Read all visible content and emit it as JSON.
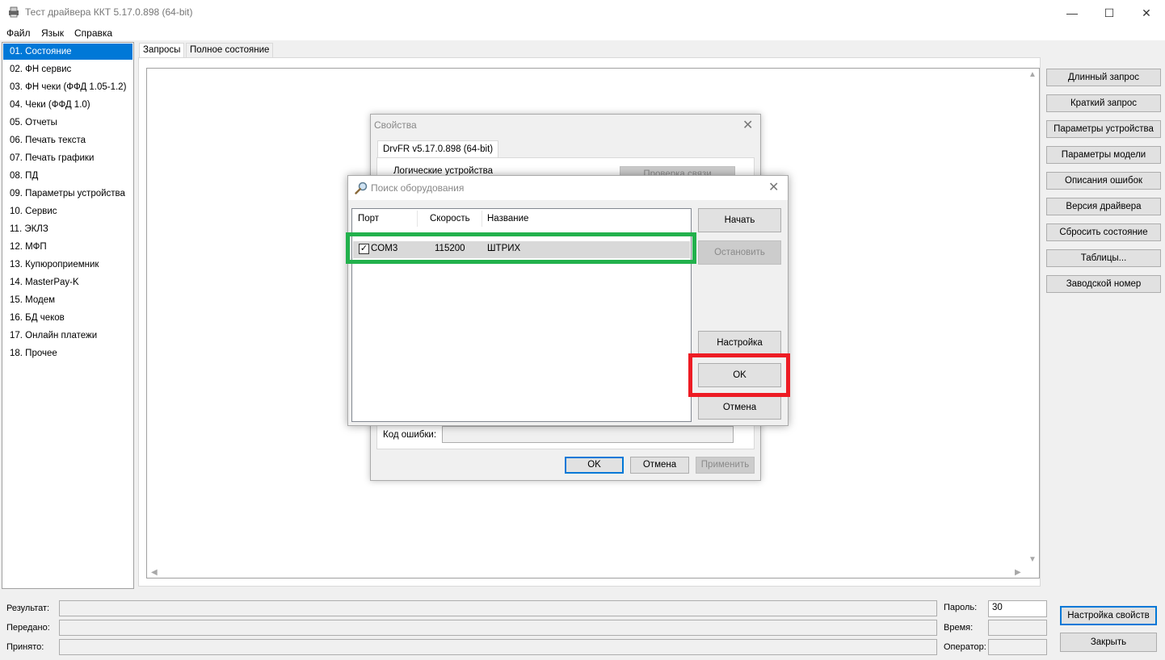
{
  "window": {
    "title": "Тест драйвера ККТ 5.17.0.898 (64-bit)",
    "icons": {
      "app": "printer-icon",
      "minimize": "minimize-icon",
      "maximize": "maximize-icon",
      "close": "close-icon"
    }
  },
  "menu": [
    "Файл",
    "Язык",
    "Справка"
  ],
  "sidebar": {
    "items": [
      "01. Состояние",
      "02. ФН сервис",
      "03. ФН чеки (ФФД 1.05-1.2)",
      "04. Чеки (ФФД 1.0)",
      "05. Отчеты",
      "06. Печать текста",
      "07. Печать графики",
      "08. ПД",
      "09. Параметры устройства",
      "10. Сервис",
      "11. ЭКЛЗ",
      "12. МФП",
      "13. Купюроприемник",
      "14. MasterPay-K",
      "15. Модем",
      "16. БД чеков",
      "17. Онлайн платежи",
      "18. Прочее"
    ],
    "selected_index": 0
  },
  "tabs": [
    "Запросы",
    "Полное состояние"
  ],
  "right_buttons": [
    "Длинный запрос",
    "Краткий запрос",
    "Параметры устройства",
    "Параметры модели",
    "Описания ошибок",
    "Версия драйвера",
    "Сбросить состояние",
    "Таблицы...",
    "Заводской номер"
  ],
  "bottom": {
    "result_label": "Результат:",
    "sent_label": "Передано:",
    "received_label": "Принято:",
    "password_label": "Пароль:",
    "password_value": "30",
    "time_label": "Время:",
    "operator_label": "Оператор:",
    "settings_button": "Настройка свойств",
    "close_button": "Закрыть"
  },
  "properties_dialog": {
    "title": "Свойства",
    "tab": "DrvFR v5.17.0.898 (64-bit)",
    "logical_devices_label": "Логические устройства",
    "check_connection_button": "Проверка связи",
    "error_code_label": "Код ошибки:",
    "ok_button": "OK",
    "cancel_button": "Отмена",
    "apply_button": "Применить"
  },
  "search_dialog": {
    "title": "Поиск оборудования",
    "icon": "magnifier-icon",
    "columns": [
      "Порт",
      "Скорость",
      "Название"
    ],
    "rows": [
      {
        "checked": true,
        "port": "COM3",
        "speed": "115200",
        "name": "ШТРИХ"
      }
    ],
    "start_button": "Начать",
    "stop_button": "Остановить",
    "settings_button": "Настройка",
    "ok_button": "OK",
    "cancel_button": "Отмена"
  },
  "annotation_colors": {
    "row_highlight": "#22b14c",
    "ok_highlight": "#ed1c24"
  }
}
